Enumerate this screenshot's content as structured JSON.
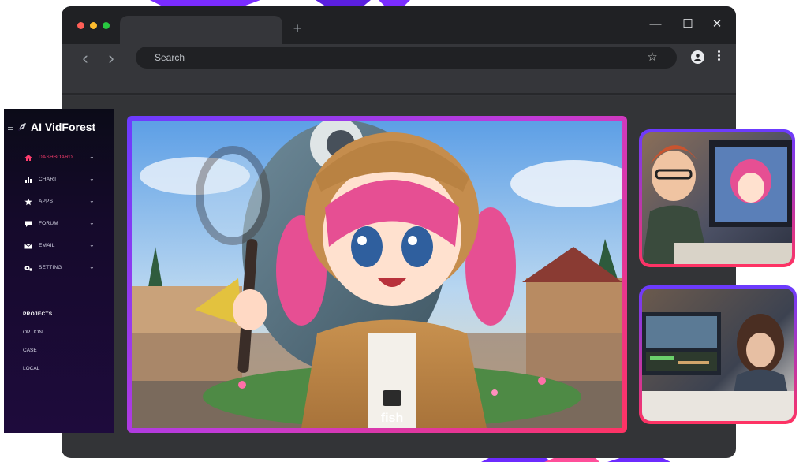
{
  "browser": {
    "window_dot_colors": [
      "#ff5f57",
      "#febc2e",
      "#28c840"
    ],
    "new_tab_label": "+",
    "back_label": "‹",
    "forward_label": "›",
    "search": {
      "placeholder": "Search",
      "value": ""
    },
    "bookmark_icon": "☆",
    "minimize_label": "—",
    "maximize_label": "☐",
    "close_label": "✕"
  },
  "sidebar": {
    "brand": "AI VidForest",
    "items": [
      {
        "label": "DASHBOARD",
        "icon": "home-icon",
        "active": true
      },
      {
        "label": "CHART",
        "icon": "chart-icon",
        "active": false
      },
      {
        "label": "APPS",
        "icon": "star-icon",
        "active": false
      },
      {
        "label": "FORUM",
        "icon": "chat-icon",
        "active": false
      },
      {
        "label": "EMAIL",
        "icon": "mail-icon",
        "active": false
      },
      {
        "label": "SETTING",
        "icon": "gear-icon",
        "active": false
      }
    ],
    "chevron": "⌄",
    "projects_heading": "PROJECTS",
    "projects": [
      "OPTION",
      "CASE",
      "LOCAL"
    ]
  },
  "main_image": {
    "caption": "fish"
  },
  "colors": {
    "accent_active": "#ff3d6e",
    "gradient_start": "#6b3bff",
    "gradient_end": "#ff3363",
    "sidebar_bg": "#150a2b",
    "browser_bg": "#333437"
  }
}
